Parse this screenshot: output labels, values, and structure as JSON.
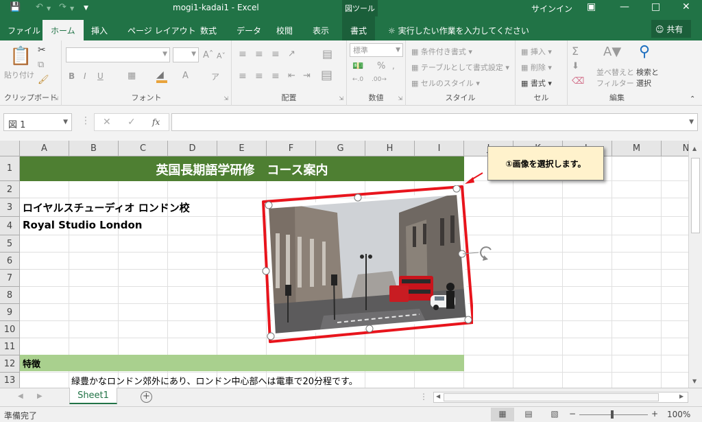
{
  "titlebar": {
    "title": "mogi1-kadai1  -  Excel",
    "context_tools": "図ツール",
    "signin": "サインイン"
  },
  "ribbon_tabs": [
    {
      "label": "ファイル"
    },
    {
      "label": "ホーム"
    },
    {
      "label": "挿入"
    },
    {
      "label": "ページ レイアウト"
    },
    {
      "label": "数式"
    },
    {
      "label": "データ"
    },
    {
      "label": "校閲"
    },
    {
      "label": "表示"
    },
    {
      "label": "書式"
    }
  ],
  "tell_me": "実行したい作業を入力してください",
  "share": "共有",
  "ribbon": {
    "clipboard": {
      "paste": "貼り付け",
      "label": "クリップボード"
    },
    "font": {
      "label": "フォント"
    },
    "alignment": {
      "label": "配置"
    },
    "number": {
      "format": "標準",
      "label": "数値"
    },
    "styles": {
      "conditional": "条件付き書式",
      "as_table": "テーブルとして書式設定",
      "cell_style": "セルのスタイル",
      "label": "スタイル"
    },
    "cells": {
      "insert": "挿入",
      "delete": "削除",
      "format": "書式",
      "label": "セル"
    },
    "editing": {
      "sort1": "並べ替えと",
      "sort2": "フィルター",
      "find1": "検索と",
      "find2": "選択",
      "label": "編集"
    }
  },
  "formula_bar": {
    "name_box": "図 1",
    "fx": "fx",
    "value": ""
  },
  "columns": [
    "A",
    "B",
    "C",
    "D",
    "E",
    "F",
    "G",
    "H",
    "I",
    "J",
    "K",
    "L",
    "M",
    "N"
  ],
  "rows": [
    "1",
    "2",
    "3",
    "4",
    "5",
    "6",
    "7",
    "8",
    "9",
    "10",
    "11",
    "12",
    "13"
  ],
  "cells": {
    "a1": "英国長期語学研修　コース案内",
    "a3": "ロイヤルスチューディオ ロンドン校",
    "a4": "Royal Studio London",
    "a12": "特徴",
    "b13": "緑豊かなロンドン郊外にあり、ロンドン中心部へは電車で20分程です。"
  },
  "callout": "①画像を選択します。",
  "sheet_tabs": [
    {
      "label": "Sheet1"
    }
  ],
  "status": {
    "ready": "準備完了",
    "zoom": "100%"
  },
  "colors": {
    "accent": "#217346",
    "title_fill": "#4e7f32",
    "feature_fill": "#a9d08e",
    "callout_fill": "#fff2cc",
    "highlight": "#e8141c"
  }
}
